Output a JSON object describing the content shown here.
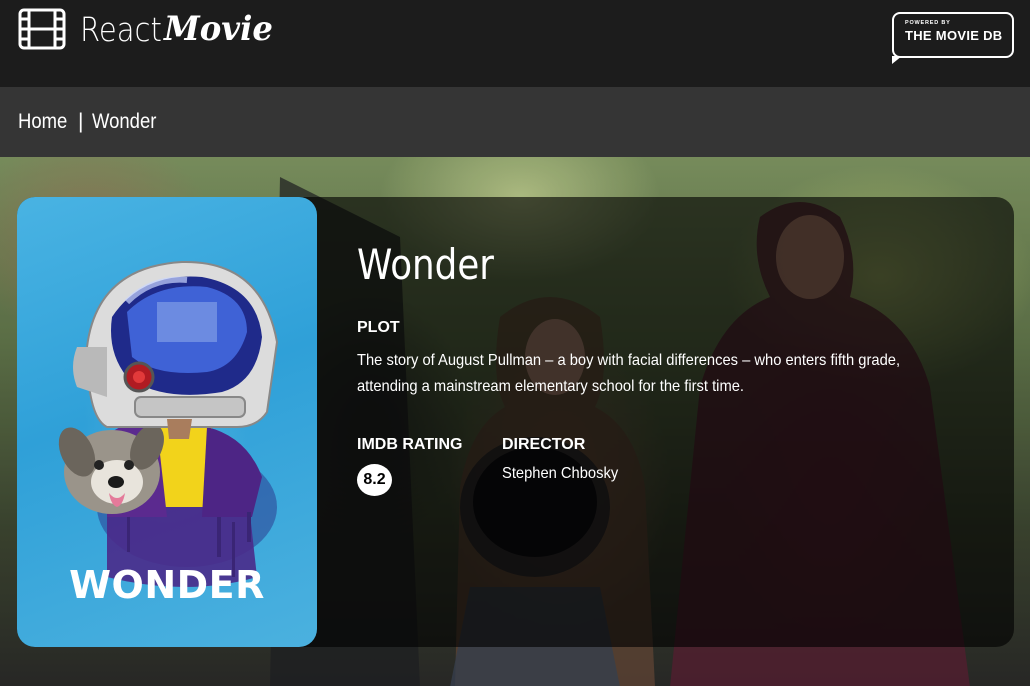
{
  "header": {
    "logo_react": "React",
    "logo_movie": "Movie",
    "tmdb_powered": "POWERED BY",
    "tmdb_name": "THE MOVIE DB"
  },
  "breadcrumb": {
    "home": "Home",
    "separator": "|",
    "current": "Wonder"
  },
  "movie": {
    "title": "Wonder",
    "poster_title": "WONDER",
    "plot_label": "PLOT",
    "plot": "The story of August Pullman – a boy with facial differences – who enters fifth grade, attending a mainstream elementary school for the first time.",
    "rating_label": "IMDB RATING",
    "rating": "8.2",
    "director_label": "DIRECTOR",
    "director": "Stephen Chbosky"
  },
  "colors": {
    "header_bg": "#1c1c1c",
    "breadcrumb_bg": "#353535",
    "poster_blue": "#2fa0d8",
    "rating_badge": "#ffffff"
  },
  "icons": {
    "logo": "film-strip-icon"
  }
}
